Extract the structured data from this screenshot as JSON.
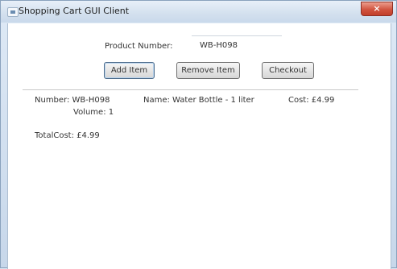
{
  "window": {
    "title": "Shopping Cart GUI Client",
    "close_glyph": "×"
  },
  "form": {
    "product_number_label": "Product Number:",
    "product_number_value": "WB-H098"
  },
  "buttons": {
    "add": "Add Item",
    "remove": "Remove Item",
    "checkout": "Checkout"
  },
  "cart": {
    "items": [
      {
        "number": "Number: WB-H098",
        "volume": "Volume: 1",
        "name": "Name: Water Bottle - 1 liter",
        "cost": "Cost: £4.99"
      }
    ],
    "total": "TotalCost: £4.99"
  },
  "icons": {
    "app_icon": "window-app-icon",
    "close_icon": "close-icon"
  },
  "colors": {
    "close_button": "#d1543f",
    "titlebar": "#d3e0ee"
  }
}
